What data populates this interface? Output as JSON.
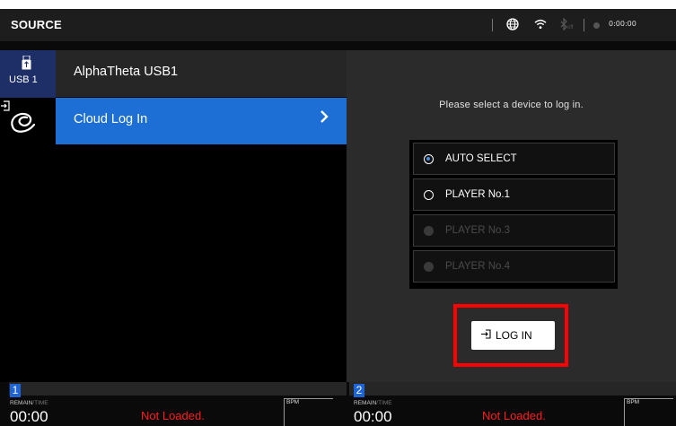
{
  "header": {
    "title": "SOURCE",
    "globe_icon": "globe-icon",
    "wifi_icon": "wifi-icon",
    "bluetooth_icon": "bluetooth-off-icon",
    "bt_state": "off",
    "clock": "0:00:00"
  },
  "sidebar": {
    "usb_label": "USB 1",
    "usb_icon": "usb-drive-icon",
    "cloud_icon": "cloud-login-icon"
  },
  "sources": {
    "items": [
      {
        "label": "AlphaTheta USB1"
      },
      {
        "label": "Cloud Log In",
        "selected": true
      }
    ],
    "accent_color": "#1d6fd6"
  },
  "login_panel": {
    "prompt": "Please select a device to log in.",
    "options": [
      {
        "label": "AUTO SELECT",
        "selected": true,
        "enabled": true
      },
      {
        "label": "PLAYER No.1",
        "selected": false,
        "enabled": true
      },
      {
        "label": "PLAYER No.3",
        "selected": false,
        "enabled": false
      },
      {
        "label": "PLAYER No.4",
        "selected": false,
        "enabled": false
      }
    ],
    "login_button": "LOG IN",
    "highlight_color": "#ff0000"
  },
  "decks": [
    {
      "number": "1",
      "remain": "REMAIN",
      "time_label": "TIME",
      "time": "00:00",
      "status": "Not Loaded.",
      "bpm_label": "BPM"
    },
    {
      "number": "2",
      "remain": "REMAIN",
      "time_label": "TIME",
      "time": "00:00",
      "status": "Not Loaded.",
      "bpm_label": "BPM"
    }
  ]
}
